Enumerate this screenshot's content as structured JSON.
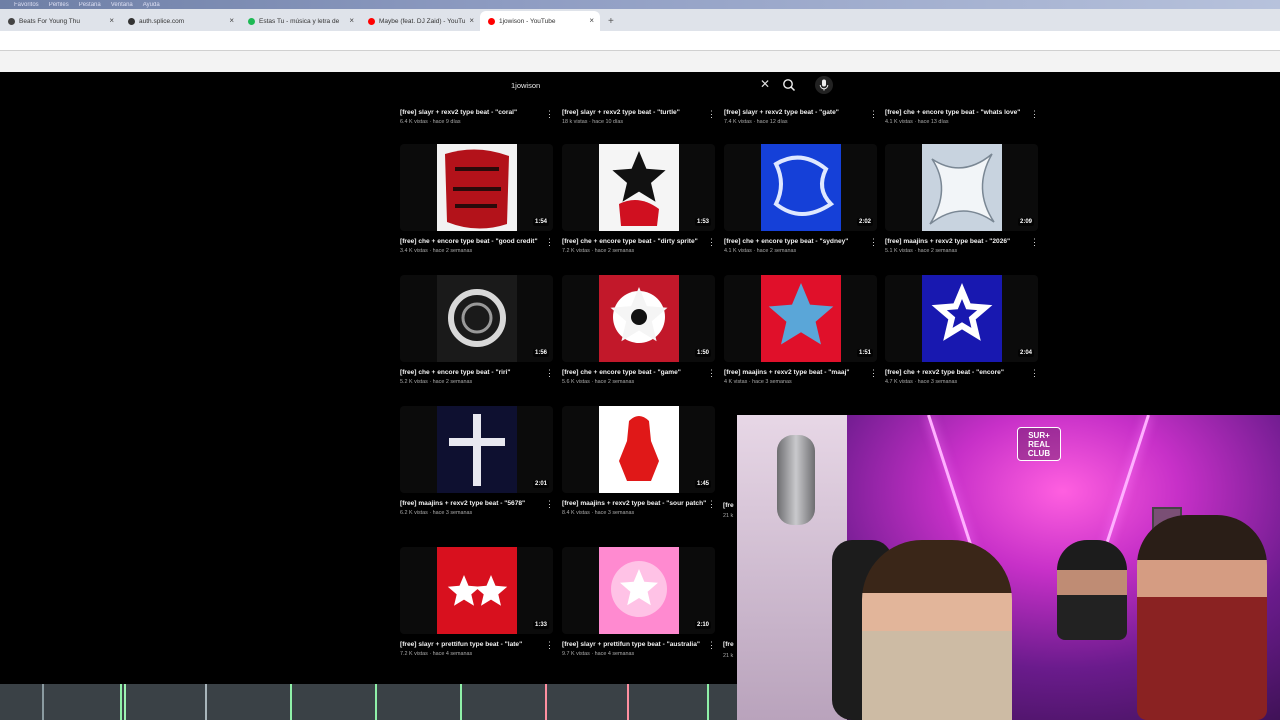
{
  "browser": {
    "menu": [
      "Favoritos",
      "Perfiles",
      "Pestaña",
      "Ventana",
      "Ayuda"
    ],
    "tabs": [
      {
        "label": "Beats For Young Thu",
        "fav_color": "#444444",
        "active": false
      },
      {
        "label": "auth.splice.com",
        "fav_color": "#333333",
        "active": false
      },
      {
        "label": "Estas Tu - música y letra de",
        "fav_color": "#1db954",
        "active": false
      },
      {
        "label": "Maybe (feat. DJ Zaid) - YouTu",
        "fav_color": "#ff0000",
        "active": false
      },
      {
        "label": "1jowison - YouTube",
        "fav_color": "#ff0000",
        "active": true
      }
    ],
    "new_tab_label": "+"
  },
  "search": {
    "query": "1jowison",
    "clear_label": "✕"
  },
  "videos": [
    {
      "title": "[free] slayr + rexv2 type beat - \"coral\"",
      "meta": "6.4 K vistas · hace 9 días",
      "duration": "",
      "art": "none"
    },
    {
      "title": "[free] slayr + rexv2 type beat - \"turtle\"",
      "meta": "18 k vistas · hace 10 días",
      "duration": "",
      "art": "none"
    },
    {
      "title": "[free] slayr + rexv2 type beat - \"gate\"",
      "meta": "7.4 K vistas · hace 12 días",
      "duration": "",
      "art": "none"
    },
    {
      "title": "[free] che + encore type beat - \"whats love\"",
      "meta": "4.1 K vistas · hace 13 días",
      "duration": "",
      "art": "none"
    },
    {
      "title": "[free] che + encore type beat - \"good credit\"",
      "meta": "3.4 K vistas · hace 2 semanas",
      "duration": "1:54",
      "art": "red-script"
    },
    {
      "title": "[free] che + encore type beat - \"dirty sprite\"",
      "meta": "7.2 K vistas · hace 2 semanas",
      "duration": "1:53",
      "art": "black-star-red"
    },
    {
      "title": "[free] che + encore type beat - \"sydney\"",
      "meta": "4.1 K vistas · hace 2 semanas",
      "duration": "2:02",
      "art": "blue-chrome"
    },
    {
      "title": "[free] maajins + rexv2 type beat - \"2026\"",
      "meta": "5.1 K vistas · hace 2 semanas",
      "duration": "2:09",
      "art": "silver-chrome"
    },
    {
      "title": "[free] che + encore type beat - \"riri\"",
      "meta": "5.2 K vistas · hace 2 semanas",
      "duration": "1:56",
      "art": "silver-ring"
    },
    {
      "title": "[free] che + encore type beat - \"game\"",
      "meta": "5.6 K vistas · hace 2 semanas",
      "duration": "1:50",
      "art": "red-burst"
    },
    {
      "title": "[free] maajins + rexv2 type beat - \"maaj\"",
      "meta": "4 K vistas · hace 3 semanas",
      "duration": "1:51",
      "art": "red-star"
    },
    {
      "title": "[free] che + rexv2 type beat - \"encore\"",
      "meta": "4.7 K vistas · hace 3 semanas",
      "duration": "2:04",
      "art": "blue-star"
    },
    {
      "title": "[free] maajins + rexv2 type beat - \"5678\"",
      "meta": "6.2 K vistas · hace 3 semanas",
      "duration": "2:01",
      "art": "navy-cross"
    },
    {
      "title": "[free] maajins + rexv2 type beat - \"sour patch\"",
      "meta": "8.4 K vistas · hace 3 semanas",
      "duration": "1:45",
      "art": "white-gummy"
    },
    {
      "title": "[free] slayr + prettifun type beat - \"late\"",
      "meta": "7.2 K vistas · hace 4 semanas",
      "duration": "1:33",
      "art": "red-stars"
    },
    {
      "title": "[free] slayr + prettifun type beat - \"australia\"",
      "meta": "9.7 K vistas · hace 4 semanas",
      "duration": "2:10",
      "art": "pink-star"
    }
  ],
  "partial_column": {
    "title_prefix": "[fre",
    "meta_prefix": "21 k"
  },
  "webcam": {
    "logo_text": "SUR+\nREAL\nCLUB"
  },
  "colors": {
    "page_bg": "#000000",
    "text": "#f1f1f1",
    "meta": "#aaaaaa",
    "accent": "#ff0000"
  }
}
